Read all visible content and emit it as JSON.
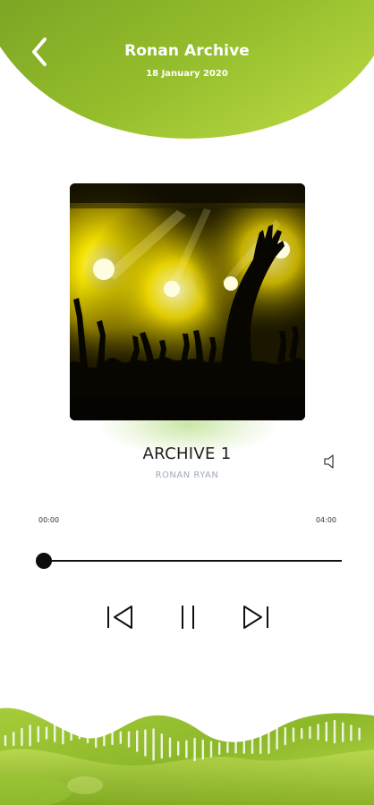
{
  "header": {
    "title": "Ronan Archive",
    "date": "18 January 2020",
    "back_icon": "chevron-left-icon"
  },
  "track": {
    "title": "ARCHIVE 1",
    "artist": "RONAN RYAN",
    "artwork": "concert crowd with raised hands under yellow stage lights"
  },
  "player": {
    "elapsed": "00:00",
    "duration": "04:00",
    "progress": 0,
    "volume_icon": "speaker-icon",
    "controls": {
      "previous_icon": "skip-previous-icon",
      "pause_icon": "pause-icon",
      "next_icon": "skip-next-icon"
    }
  },
  "colors": {
    "accent_light": "#a9cf3c",
    "accent_dark": "#6f9a1f",
    "text_dark": "#1f1f1f",
    "artist_grey": "#9fa9bd"
  }
}
